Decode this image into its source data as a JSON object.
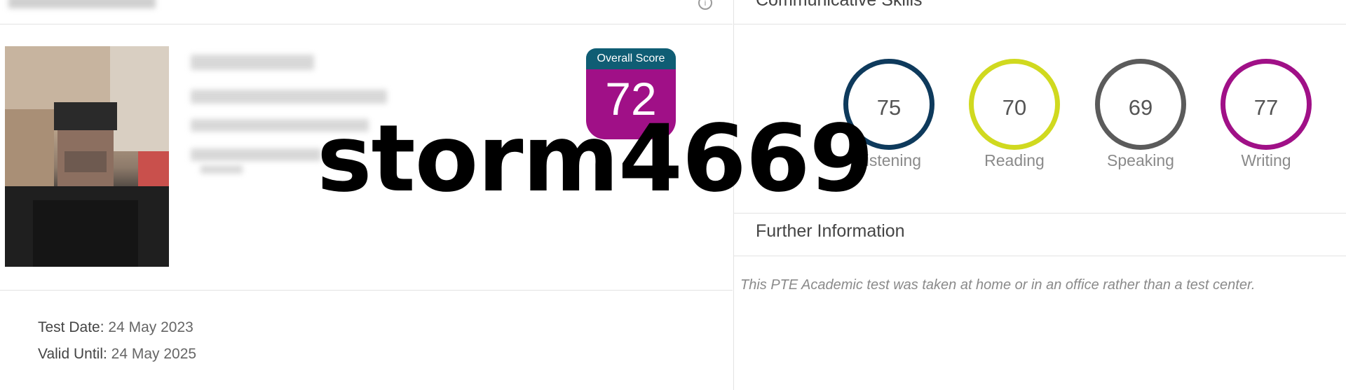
{
  "overall": {
    "label": "Overall Score",
    "score": "72",
    "color_header": "#0f5d74",
    "color_body": "#a01087"
  },
  "watermark": "storm4669",
  "dates": {
    "test_date_label": "Test Date:",
    "test_date": "24 May 2023",
    "valid_until_label": "Valid Until:",
    "valid_until": "24 May 2025"
  },
  "communicative": {
    "title": "Communicative Skills",
    "skills": [
      {
        "name": "Listening",
        "score": "75",
        "color": "#0e3a5c"
      },
      {
        "name": "Reading",
        "score": "70",
        "color": "#d0d91f"
      },
      {
        "name": "Speaking",
        "score": "69",
        "color": "#5b5b5b"
      },
      {
        "name": "Writing",
        "score": "77",
        "color": "#a01087"
      }
    ]
  },
  "further": {
    "title": "Further Information",
    "note": "This PTE Academic test was taken at home or in an office rather than a test center."
  },
  "icons": {
    "info": "info-icon"
  }
}
